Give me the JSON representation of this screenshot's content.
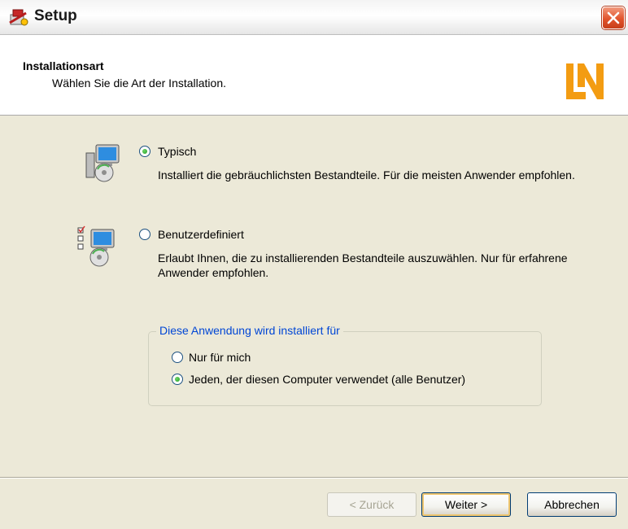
{
  "window": {
    "title": "Setup"
  },
  "header": {
    "heading": "Installationsart",
    "subheading": "Wählen Sie die Art der Installation.",
    "logo_text": "LN",
    "logo_color": "#F39C12"
  },
  "install_type": {
    "options": [
      {
        "label": "Typisch",
        "selected": true,
        "description": "Installiert die gebräuchlichsten Bestandteile. Für die meisten Anwender empfohlen.",
        "icon": "typical-install-icon"
      },
      {
        "label": "Benutzerdefiniert",
        "selected": false,
        "description": "Erlaubt Ihnen, die zu installierenden Bestandteile auszuwählen. Nur für erfahrene Anwender empfohlen.",
        "icon": "custom-install-icon"
      }
    ]
  },
  "install_for": {
    "legend": "Diese Anwendung wird installiert für",
    "options": [
      {
        "label": "Nur für mich",
        "selected": false
      },
      {
        "label": "Jeden, der diesen Computer verwendet (alle Benutzer)",
        "selected": true
      }
    ]
  },
  "buttons": {
    "back": "< Zurück",
    "next": "Weiter >",
    "cancel": "Abbrechen"
  },
  "colors": {
    "dialog_bg": "#ECE9D8",
    "accent_blue": "#0046D5",
    "radio_selected": "#21A121",
    "close_red": "#E1532B"
  }
}
